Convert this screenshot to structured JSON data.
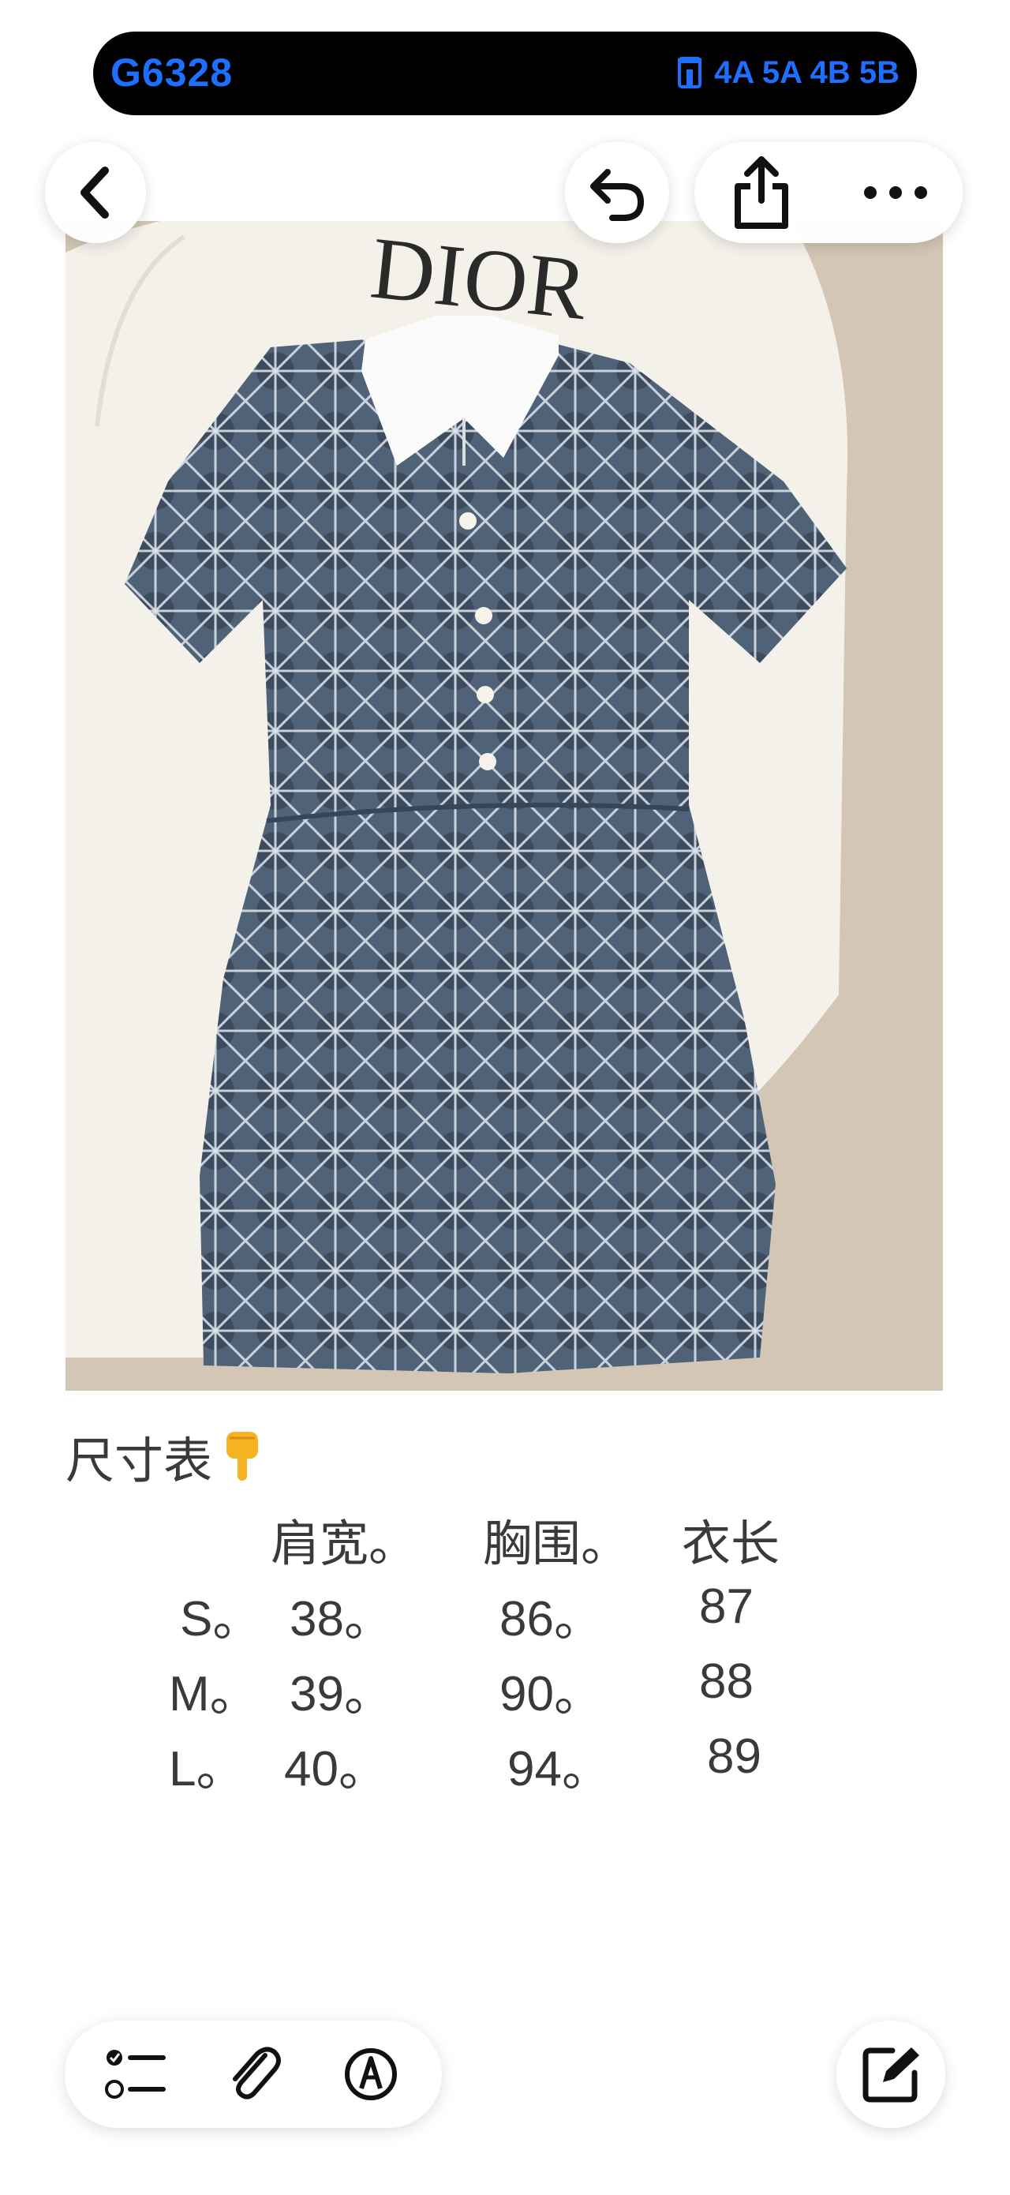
{
  "status": {
    "title": "G6328",
    "right_text": "4A 5A 4B 5B",
    "accent_color": "#1f6fff"
  },
  "toolbar": {
    "back_icon": "chevron-left-icon",
    "undo_icon": "undo-icon",
    "share_icon": "share-icon",
    "more_icon": "ellipsis-icon"
  },
  "photo": {
    "brand_text": "DIOR",
    "description_icon": "dress-photo"
  },
  "note": {
    "heading": "尺寸表",
    "heading_emoji_icon": "pointing-down-hand-icon",
    "table": {
      "headers": [
        "肩宽。",
        "胸围。",
        "衣长"
      ],
      "rows": [
        {
          "size": "S。",
          "shoulder": "38。",
          "chest": "86。",
          "length": "87"
        },
        {
          "size": "M。",
          "shoulder": "39。",
          "chest": "90。",
          "length": "88"
        },
        {
          "size": "L。",
          "shoulder": "40。",
          "chest": "94。",
          "length": "89"
        }
      ]
    }
  },
  "bottom_toolbar": {
    "checklist_icon": "checklist-icon",
    "attach_icon": "paperclip-icon",
    "markup_icon": "pen-markup-icon",
    "compose_icon": "compose-icon"
  }
}
